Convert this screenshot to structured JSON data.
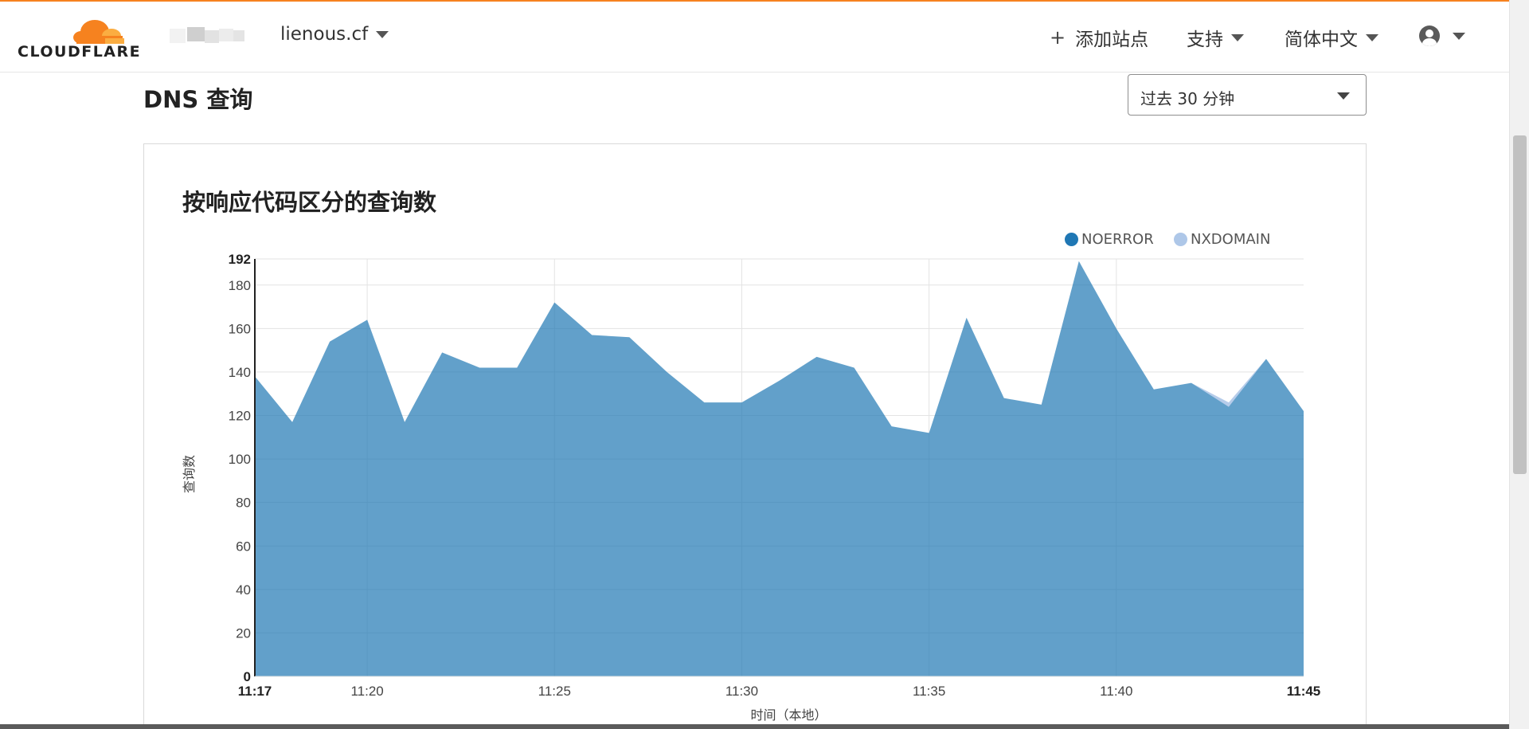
{
  "header": {
    "logo_text": "CLOUDFLARE",
    "zone": "lienous.cf",
    "add_site": "添加站点",
    "support": "支持",
    "language": "简体中文"
  },
  "page": {
    "title": "DNS 查询",
    "time_range": "过去 30 分钟"
  },
  "card": {
    "title": "按响应代码区分的查询数"
  },
  "legend": [
    {
      "label": "NOERROR",
      "color": "#1f77b4"
    },
    {
      "label": "NXDOMAIN",
      "color": "#aec7e8"
    }
  ],
  "chart_data": {
    "type": "area",
    "stacked": true,
    "title": "按响应代码区分的查询数",
    "xlabel": "时间（本地）",
    "ylabel": "查询数",
    "ylim": [
      0,
      192
    ],
    "y_ticks": [
      0,
      20,
      40,
      60,
      80,
      100,
      120,
      140,
      160,
      180,
      192
    ],
    "x_ticks": [
      "11:17",
      "11:20",
      "11:25",
      "11:30",
      "11:35",
      "11:40",
      "11:45"
    ],
    "x": [
      "11:17",
      "11:18",
      "11:19",
      "11:20",
      "11:21",
      "11:22",
      "11:23",
      "11:24",
      "11:25",
      "11:26",
      "11:27",
      "11:28",
      "11:29",
      "11:30",
      "11:31",
      "11:32",
      "11:33",
      "11:34",
      "11:35",
      "11:36",
      "11:37",
      "11:38",
      "11:39",
      "11:40",
      "11:41",
      "11:42",
      "11:43",
      "11:44",
      "11:45"
    ],
    "series": [
      {
        "name": "NOERROR",
        "color": "#1f77b4",
        "values": [
          138,
          117,
          154,
          164,
          117,
          149,
          142,
          142,
          172,
          157,
          156,
          140,
          126,
          126,
          136,
          147,
          142,
          115,
          112,
          165,
          128,
          125,
          191,
          160,
          132,
          135,
          124,
          146,
          122
        ]
      },
      {
        "name": "NXDOMAIN",
        "color": "#aec7e8",
        "values": [
          0,
          0,
          0,
          0,
          0,
          0,
          0,
          0,
          0,
          0,
          0,
          0,
          0,
          0,
          0,
          0,
          0,
          0,
          0,
          0,
          0,
          0,
          0,
          0,
          0,
          0,
          2,
          0,
          0
        ]
      }
    ],
    "grid": true,
    "legend_position": "top-right"
  }
}
